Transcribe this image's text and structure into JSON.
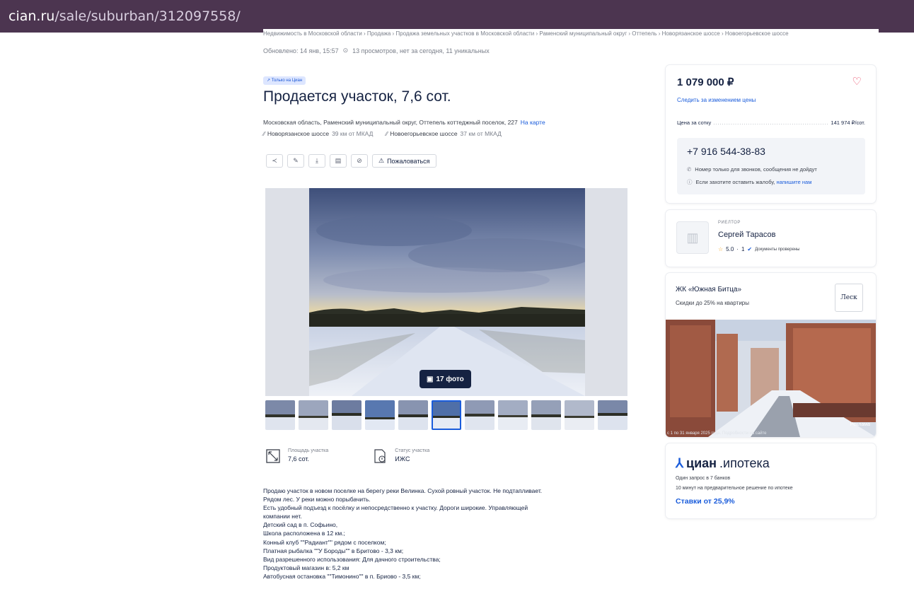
{
  "browser": {
    "host": "cian.ru",
    "path": "/sale/suburban/312097558/"
  },
  "breadcrumbs": "Недвижимость в Московской области  ›  Продажа  ›  Продажа земельных участков в Московской области  ›  Раменский муниципальный округ  ›  Оттепель  ›  Новорязанское шоссе  ›  Новоегорьевское шоссе",
  "meta": {
    "updated": "Обновлено: 14 янв, 15:57",
    "views": "13 просмотров, нет за сегодня, 11 уникальных"
  },
  "listing": {
    "badge": "Только на Циан",
    "title": "Продается участок, 7,6 сот.",
    "address": "Московская область, Раменский муниципальный округ, Оттепель коттеджный поселок, 227",
    "map_link": "На карте",
    "highways": [
      {
        "name": "Новорязанское шоссе",
        "distance": "39 км от МКАД"
      },
      {
        "name": "Новоегорьевское шоссе",
        "distance": "37 км от МКАД"
      }
    ],
    "complain_label": "Пожаловаться",
    "photo_count": "17 фото",
    "facts": [
      {
        "label": "Площадь участка",
        "value": "7,6 сот.",
        "icon": "area-icon"
      },
      {
        "label": "Статус участка",
        "value": "ИЖС",
        "icon": "document-status-icon"
      }
    ],
    "description": [
      "Продаю участок в новом поселке на берегу реки Велинка. Сухой ровный участок. Не подтапливает.",
      "Рядом лес. У реки можно порыбачить.",
      "Есть удобный подъезд к посёлку и непосредственно к участку. Дороги широкие. Управляющей",
      "компании нет.",
      "Детский сад в п. Софьино,",
      "Школа расположена в 12 км.;",
      "Конный клуб \"\"Радиант\"\" рядом с поселком;",
      "Платная рыбалка \"\"У Бороды\"\" в Бритово - 3,3 км;",
      "Вид разрешенного использования: Для дачного строительства;",
      "Продуктовый магазин в: 5,2 км",
      "Автобусная остановка \"\"Тимонино\"\" в п. Бриово - 3,5 км;"
    ]
  },
  "price_card": {
    "price": "1 079 000 ₽",
    "follow": "Следить за изменением цены",
    "per_sotka_label": "Цена за сотку",
    "per_sotka_value": "141 974 ₽/сот.",
    "phone": "+7 916 544-38-83",
    "phone_note": "Номер только для звонков, сообщения не дойдут",
    "complaint_text": "Если захотите оставить жалобу,",
    "complaint_link": "напишите нам"
  },
  "agent": {
    "role": "РИЕЛТОР",
    "name": "Сергей Тарасов",
    "rating": "5.0",
    "reviews": "1",
    "docs": "Документы проверены"
  },
  "ad": {
    "title": "ЖК «Южная Битца»",
    "subtitle": "Скидки до 25% на квартиры",
    "logo": "Леск",
    "caption": "с 1 по 31 января 2025 года. Подробности на сайте",
    "tag": "Реклама"
  },
  "mortgage": {
    "brand": "циан",
    "suffix": ".ипотека",
    "line1": "Один запрос в 7 банков",
    "line2": "10 минут на предварительное решение по ипотеке",
    "rate": "Ставки от 25,9%"
  },
  "colors": {
    "urlbar": "#4c3550",
    "accent": "#1a5cdb",
    "heart": "#e84260",
    "text": "#152242"
  }
}
